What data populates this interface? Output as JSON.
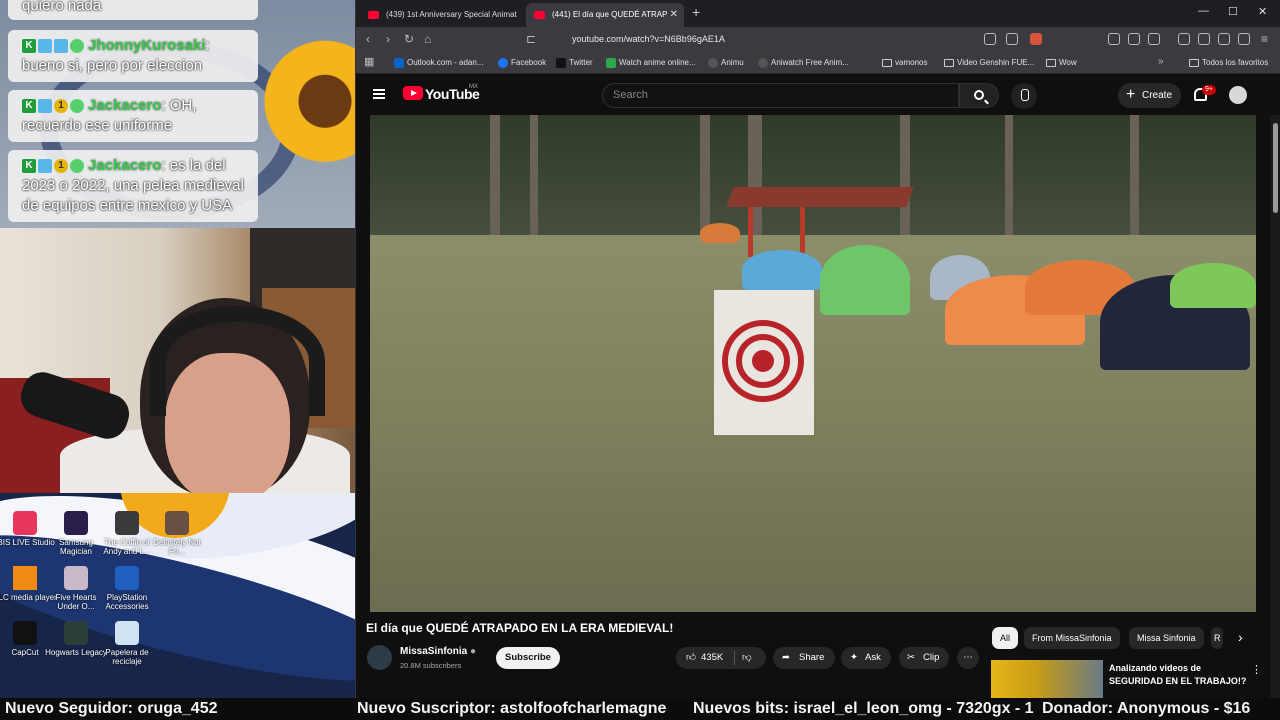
{
  "chat": {
    "top_text": "quiero nada",
    "messages": [
      {
        "user": "JhonnyKurosaki",
        "text": ": bueno si, pero por eleccion"
      },
      {
        "user": "Jackacero",
        "text": ": OH, recuerdo ese uniforme"
      },
      {
        "user": "Jackacero",
        "text": ": es la del 2023 o 2022, una pelea medieval de equipos entre mexico y USA"
      }
    ]
  },
  "desktop": {
    "icons": [
      {
        "label": "IBIS LIVE Studio",
        "color": "#e8365d"
      },
      {
        "label": "Samsung Magician",
        "color": "#2a1d4a"
      },
      {
        "label": "The Coffin of Andy and L...",
        "color": "#3a3a3a"
      },
      {
        "label": "Definitely Not Fri...",
        "color": "#6a5040"
      },
      {
        "label": "VLC media player",
        "color": "#ef8a12"
      },
      {
        "label": "Five Hearts Under O...",
        "color": "#c8b8c8"
      },
      {
        "label": "PlayStation Accessories",
        "color": "#1f5fbf"
      },
      {
        "label": "CapCut",
        "color": "#111111"
      },
      {
        "label": "Hogwarts Legacy",
        "color": "#2c3e3a"
      },
      {
        "label": "Papelera de reciclaje",
        "color": "#cfe3f2"
      }
    ]
  },
  "browser": {
    "tabs": [
      {
        "label": "(439) 1st Anniversary Special Animat",
        "active": false
      },
      {
        "label": "(441) El día que QUEDÉ ATRAP",
        "active": true
      }
    ],
    "url": "youtube.com/watch?v=N6Bb96gAE1A",
    "bookmarks": [
      {
        "label": "Outlook.com - adan...",
        "color": "#0a64c8"
      },
      {
        "label": "Facebook",
        "color": "#1877f2"
      },
      {
        "label": "Twitter",
        "color": "#111111"
      },
      {
        "label": "Watch anime online...",
        "color": "#2ba84a"
      },
      {
        "label": "Animu",
        "color": "#555555"
      },
      {
        "label": "Aniwatch Free Anim...",
        "color": "#555555"
      },
      {
        "label": "vamonos",
        "folder": true
      },
      {
        "label": "Video Genshin FUE...",
        "folder": true
      },
      {
        "label": "Wow",
        "folder": true
      }
    ],
    "all_bookmarks": "Todos los favoritos"
  },
  "youtube": {
    "logo_text": "YouTube",
    "region": "MX",
    "search_placeholder": "Search",
    "create_label": "Create",
    "notifications": "9+",
    "video_title": "El día que QUEDÉ ATRAPADO EN LA ERA MEDIEVAL!",
    "channel": "MissaSinfonia",
    "subscribers": "20.8M subscribers",
    "subscribe_label": "Subscribe",
    "likes": "435K",
    "share_label": "Share",
    "ask_label": "Ask",
    "clip_label": "Clip",
    "chips": [
      "All",
      "From MissaSinfonia",
      "Missa Sinfonia",
      "R"
    ],
    "recommended_title": "Analizando videos de SEGURIDAD EN EL TRABAJO!?"
  },
  "ticker": [
    "Nuevo Seguidor: oruga_452",
    "Nuevo Suscriptor: astolfoofcharlemagne",
    "Nuevos bits: israel_el_leon_omg - 7320gx - 1",
    "Donador: Anonymous - $16"
  ],
  "colors": {
    "youtube_red": "#ff0033",
    "chat_user": "#37c94a",
    "page_bg": "#0f0f0f"
  }
}
